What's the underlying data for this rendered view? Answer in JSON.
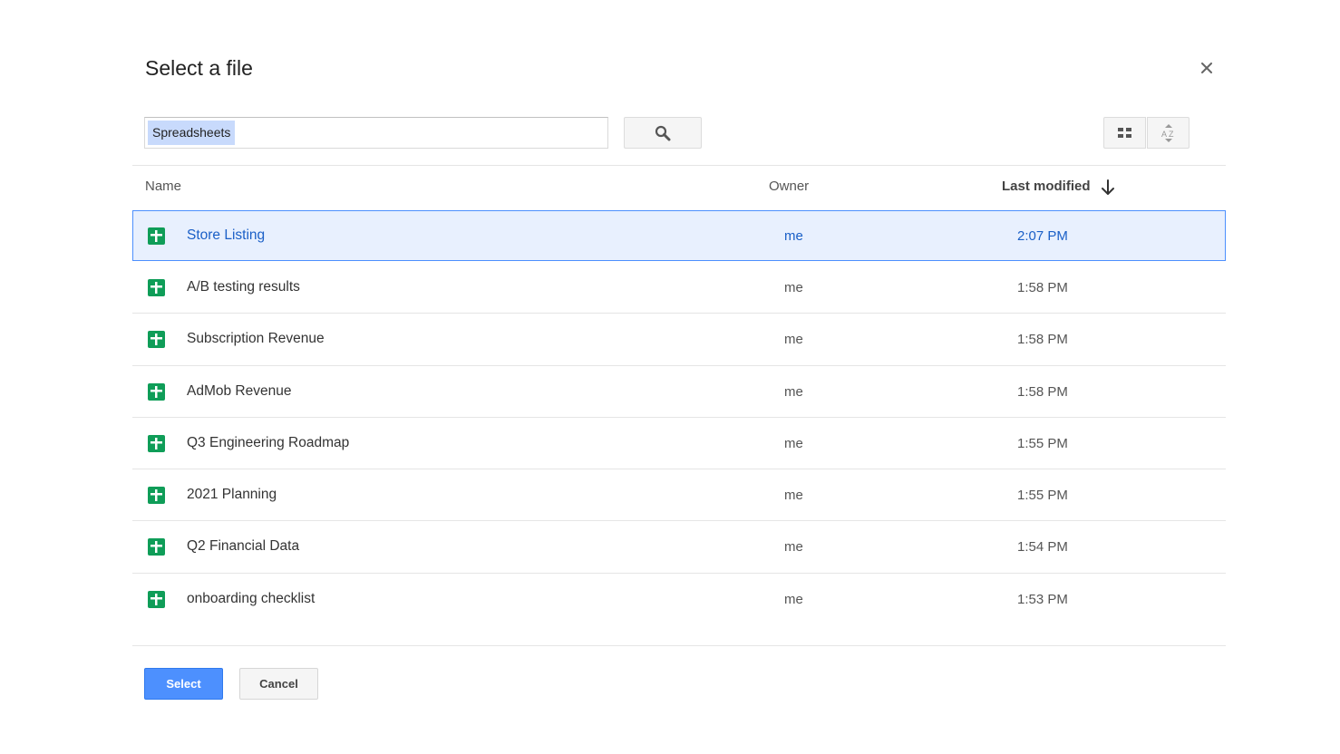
{
  "dialog": {
    "title": "Select a file"
  },
  "search": {
    "query": "Spreadsheets"
  },
  "columns": {
    "name": "Name",
    "owner": "Owner",
    "last_modified": "Last modified"
  },
  "files": [
    {
      "name": "Store Listing",
      "owner": "me",
      "modified": "2:07 PM",
      "selected": true
    },
    {
      "name": "A/B testing results",
      "owner": "me",
      "modified": "1:58 PM"
    },
    {
      "name": "Subscription Revenue",
      "owner": "me",
      "modified": "1:58 PM"
    },
    {
      "name": "AdMob Revenue",
      "owner": "me",
      "modified": "1:58 PM"
    },
    {
      "name": "Q3 Engineering Roadmap",
      "owner": "me",
      "modified": "1:55 PM"
    },
    {
      "name": "2021 Planning",
      "owner": "me",
      "modified": "1:55 PM"
    },
    {
      "name": "Q2 Financial Data",
      "owner": "me",
      "modified": "1:54 PM"
    },
    {
      "name": "onboarding checklist",
      "owner": "me",
      "modified": "1:53 PM"
    }
  ],
  "actions": {
    "select_label": "Select",
    "cancel_label": "Cancel"
  },
  "icons": {
    "close": "close-icon",
    "search": "search-icon",
    "grid_view": "grid-view-icon",
    "sort": "sort-az-icon",
    "sort_direction": "arrow-down-icon",
    "file": "spreadsheet-icon"
  },
  "colors": {
    "accent": "#4d90fe",
    "selected_row_bg": "#e8f0fe",
    "selected_text": "#1a5fc7",
    "sheets_green": "#0f9d58"
  }
}
